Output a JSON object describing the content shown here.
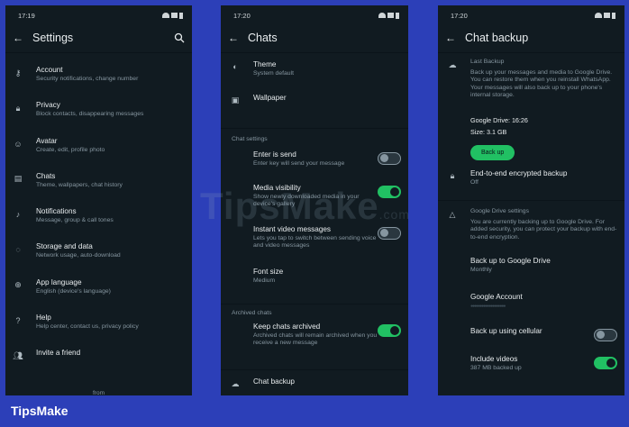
{
  "brand": "TipsMake",
  "watermark": {
    "main": "TipsMake",
    "suffix": ".com"
  },
  "screens": [
    {
      "time": "17:19",
      "title": "Settings",
      "items": [
        {
          "label": "Account",
          "sub": "Security notifications, change number",
          "icon": "key-icon"
        },
        {
          "label": "Privacy",
          "sub": "Block contacts, disappearing messages",
          "icon": "lock-icon"
        },
        {
          "label": "Avatar",
          "sub": "Create, edit, profile photo",
          "icon": "avatar-icon"
        },
        {
          "label": "Chats",
          "sub": "Theme, wallpapers, chat history",
          "icon": "chat-icon"
        },
        {
          "label": "Notifications",
          "sub": "Message, group & call tones",
          "icon": "bell-icon"
        },
        {
          "label": "Storage and data",
          "sub": "Network usage, auto-download",
          "icon": "storage-icon"
        },
        {
          "label": "App language",
          "sub": "English (device's language)",
          "icon": "globe-icon"
        },
        {
          "label": "Help",
          "sub": "Help center, contact us, privacy policy",
          "icon": "help-icon"
        },
        {
          "label": "Invite a friend",
          "sub": "",
          "icon": "people-icon"
        }
      ],
      "from": "from"
    },
    {
      "time": "17:20",
      "title": "Chats",
      "theme": {
        "label": "Theme",
        "sub": "System default"
      },
      "wallpaper": {
        "label": "Wallpaper"
      },
      "chat_settings_header": "Chat settings",
      "enter_send": {
        "label": "Enter is send",
        "sub": "Enter key will send your message",
        "on": false
      },
      "media_visibility": {
        "label": "Media visibility",
        "sub": "Show newly downloaded media in your device's gallery",
        "on": true
      },
      "instant_video": {
        "label": "Instant video messages",
        "sub": "Lets you tap to switch between sending voice and video messages",
        "on": false
      },
      "font_size": {
        "label": "Font size",
        "sub": "Medium"
      },
      "archived_header": "Archived chats",
      "keep_archived": {
        "label": "Keep chats archived",
        "sub": "Archived chats will remain archived when you receive a new message",
        "on": true
      },
      "chat_backup": {
        "label": "Chat backup"
      }
    },
    {
      "time": "17:20",
      "title": "Chat backup",
      "last_backup_header": "Last Backup",
      "last_backup_desc": "Back up your messages and media to Google Drive. You can restore them when you reinstall WhatsApp. Your messages will also back up to your phone's internal storage.",
      "gdrive_line": "Google Drive: 16:26",
      "size_line": "Size: 3.1 GB",
      "backup_button": "Back up",
      "e2e": {
        "label": "End-to-end encrypted backup",
        "sub": "Off"
      },
      "gdrive_settings_header": "Google Drive settings",
      "gdrive_desc": "You are currently backing up to Google Drive. For added security, you can protect your backup with end-to-end encryption.",
      "backup_to": {
        "label": "Back up to Google Drive",
        "sub": "Monthly"
      },
      "google_account": {
        "label": "Google Account",
        "sub": "●●●●●●●●●●●●●●●●●●●"
      },
      "cellular": {
        "label": "Back up using cellular",
        "on": false
      },
      "videos": {
        "label": "Include videos",
        "sub": "387 MB backed up",
        "on": true
      }
    }
  ]
}
